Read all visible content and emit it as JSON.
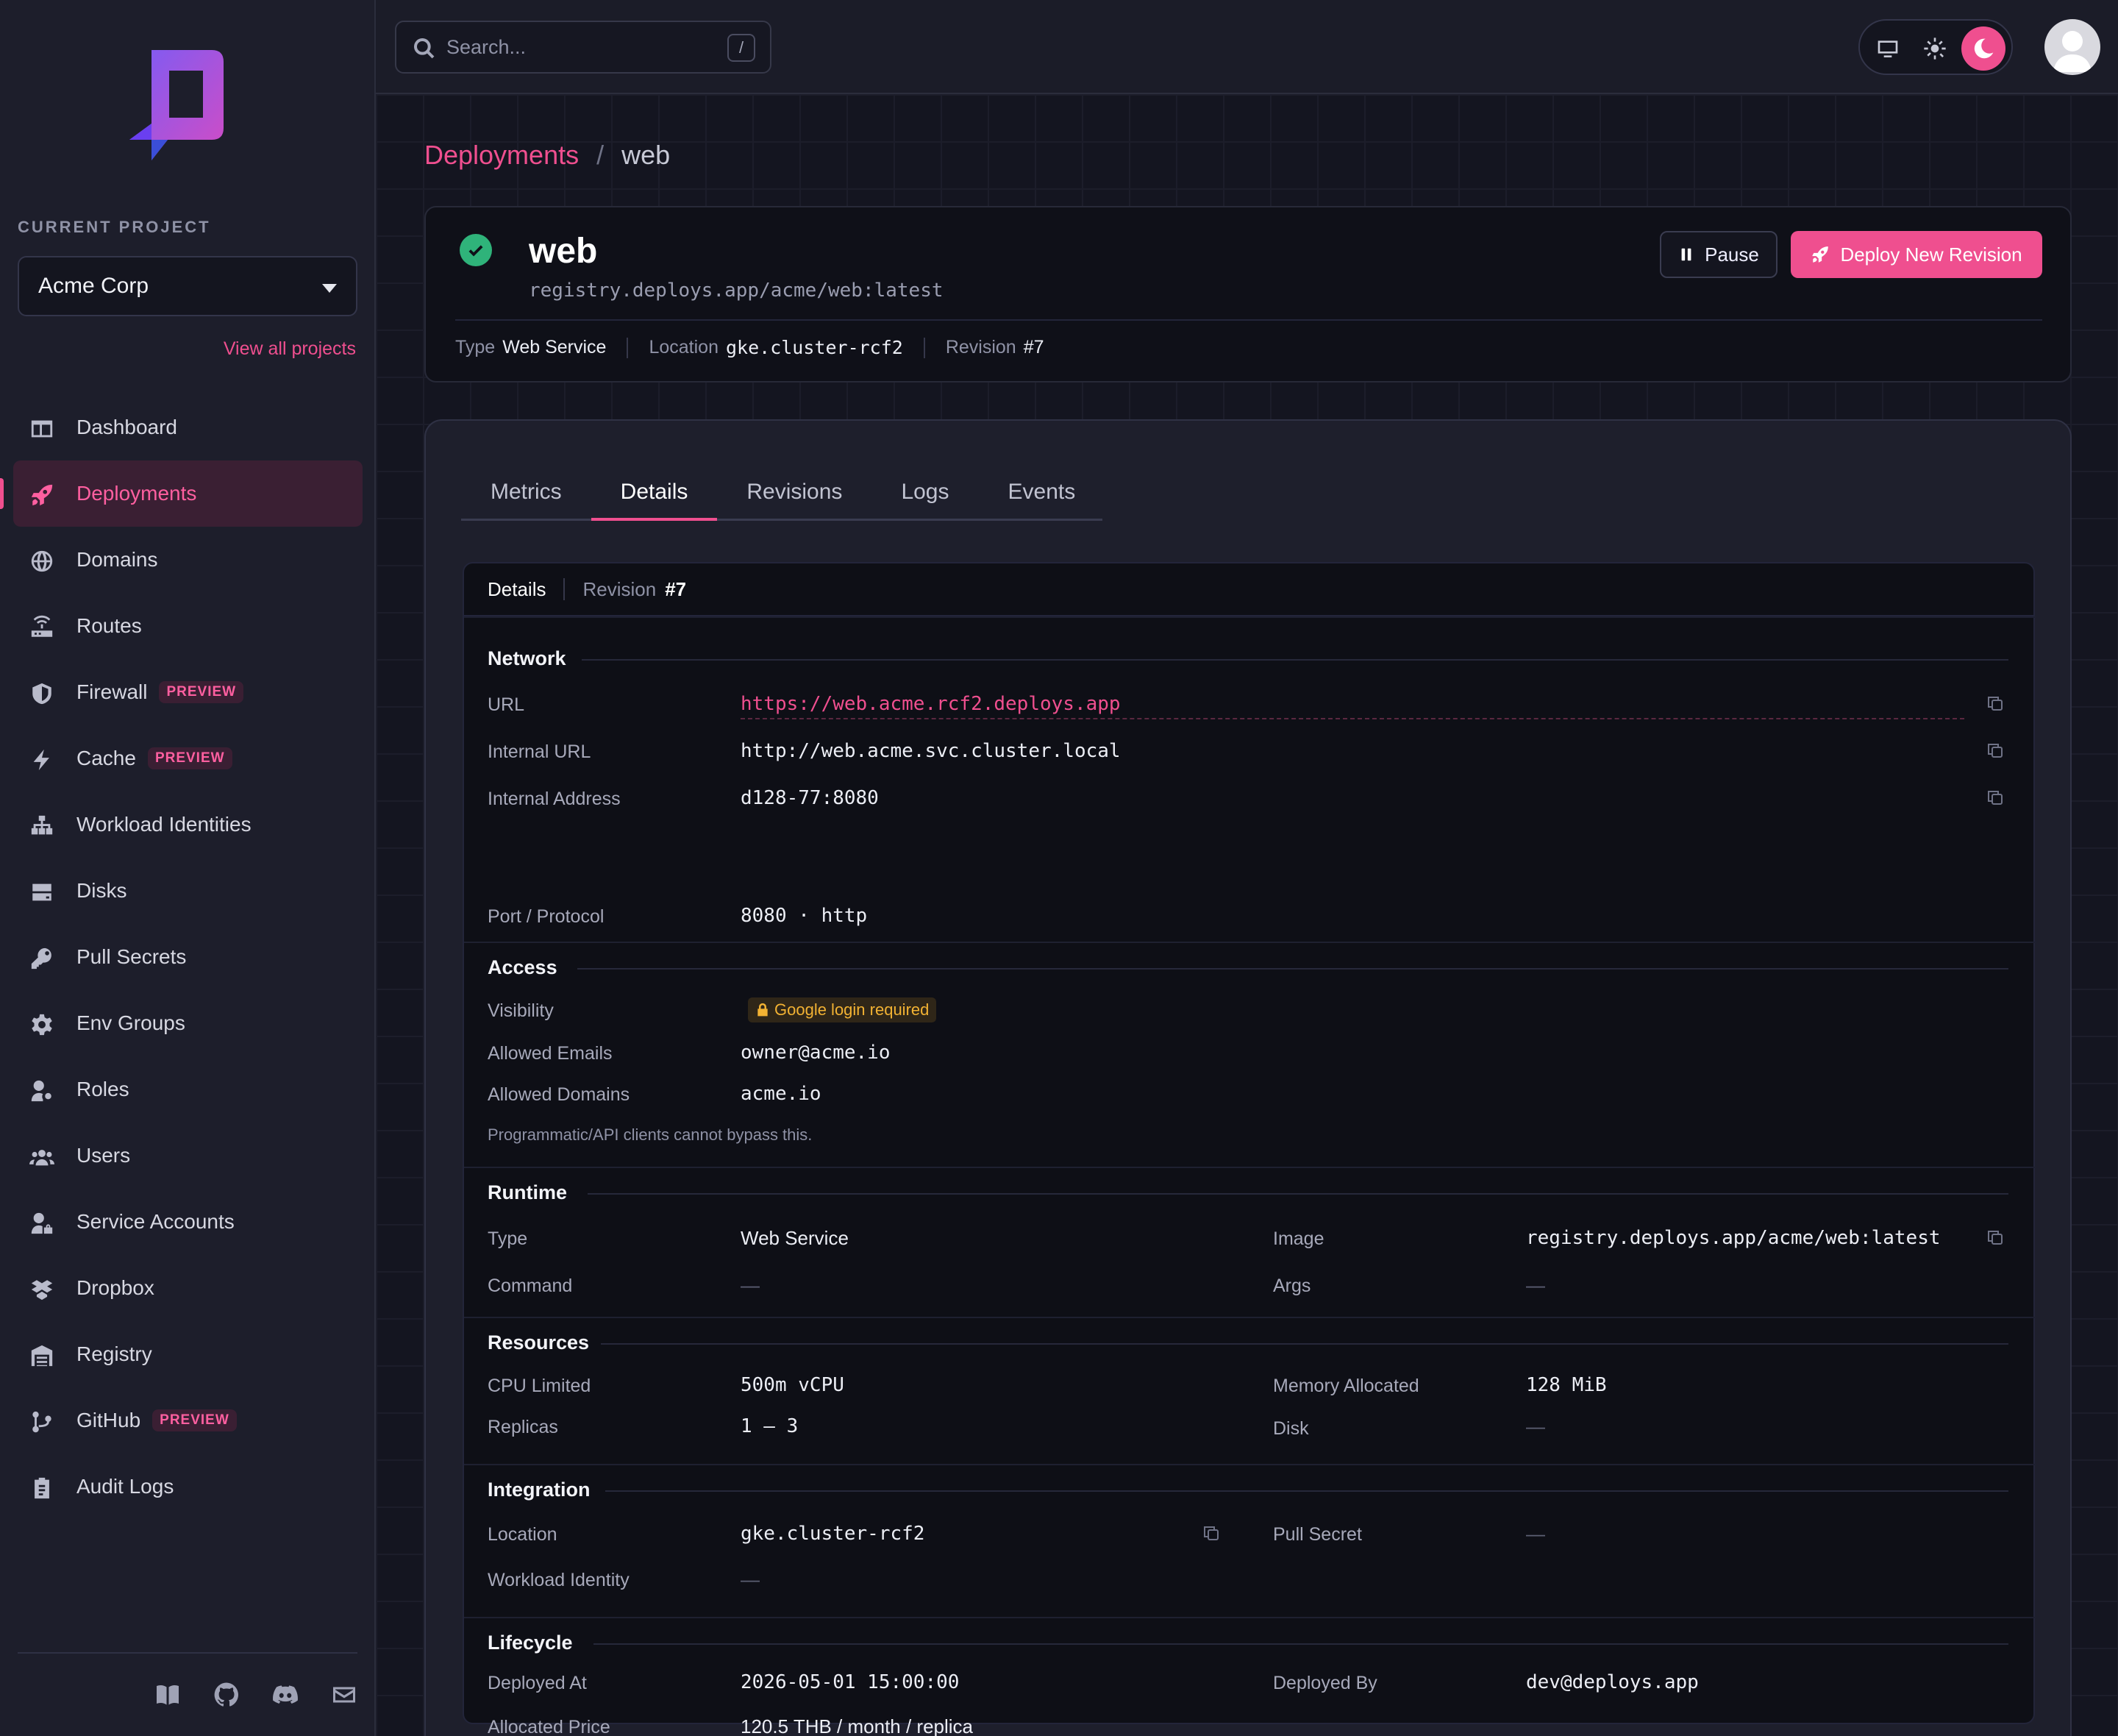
{
  "sidebar": {
    "current_project_label": "CURRENT PROJECT",
    "project_name": "Acme Corp",
    "view_all": "View all projects",
    "nav": [
      {
        "label": "Dashboard",
        "icon": "dashboard-icon"
      },
      {
        "label": "Deployments",
        "icon": "rocket-icon",
        "active": true
      },
      {
        "label": "Domains",
        "icon": "globe-icon"
      },
      {
        "label": "Routes",
        "icon": "router-icon"
      },
      {
        "label": "Firewall",
        "icon": "shield-icon",
        "badge": "PREVIEW"
      },
      {
        "label": "Cache",
        "icon": "bolt-icon",
        "badge": "PREVIEW"
      },
      {
        "label": "Workload Identities",
        "icon": "sitemap-icon"
      },
      {
        "label": "Disks",
        "icon": "disk-icon"
      },
      {
        "label": "Pull Secrets",
        "icon": "key-icon"
      },
      {
        "label": "Env Groups",
        "icon": "gear-icon"
      },
      {
        "label": "Roles",
        "icon": "user-gear-icon"
      },
      {
        "label": "Users",
        "icon": "users-icon"
      },
      {
        "label": "Service Accounts",
        "icon": "user-lock-icon"
      },
      {
        "label": "Dropbox",
        "icon": "box-icon"
      },
      {
        "label": "Registry",
        "icon": "warehouse-icon"
      },
      {
        "label": "GitHub",
        "icon": "branch-icon",
        "badge": "PREVIEW"
      },
      {
        "label": "Audit Logs",
        "icon": "clipboard-icon"
      }
    ],
    "footer_icons": [
      "book-icon",
      "github-icon",
      "discord-icon",
      "mail-icon"
    ]
  },
  "topbar": {
    "search_placeholder": "Search...",
    "search_shortcut": "/",
    "theme_modes": [
      "monitor-icon",
      "sun-icon",
      "moon-icon"
    ],
    "active_theme": "moon-icon"
  },
  "breadcrumb": {
    "parent": "Deployments",
    "separator": "/",
    "current": "web"
  },
  "deployment": {
    "name": "web",
    "image": "registry.deploys.app/acme/web:latest",
    "status": "check-circle-icon",
    "pause_label": "Pause",
    "deploy_label": "Deploy New Revision",
    "meta": {
      "type_label": "Type",
      "type_value": "Web Service",
      "location_label": "Location",
      "location_value": "gke.cluster-rcf2",
      "revision_label": "Revision",
      "revision_value": "#7"
    }
  },
  "tabs": [
    "Metrics",
    "Details",
    "Revisions",
    "Logs",
    "Events"
  ],
  "active_tab": "Details",
  "details": {
    "head_title": "Details",
    "revision_label": "Revision",
    "revision_value": "#7",
    "network": {
      "title": "Network",
      "url_label": "URL",
      "url": "https://web.acme.rcf2.deploys.app",
      "internal_url_label": "Internal URL",
      "internal_url": "http://web.acme.svc.cluster.local",
      "internal_address_label": "Internal Address",
      "internal_address": "d128-77:8080",
      "port_label": "Port / Protocol",
      "port": "8080 · http"
    },
    "access": {
      "title": "Access",
      "visibility_label": "Visibility",
      "visibility": "Google login required",
      "emails_label": "Allowed Emails",
      "emails": "owner@acme.io",
      "domains_label": "Allowed Domains",
      "domains": "acme.io",
      "note": "Programmatic/API clients cannot bypass this."
    },
    "runtime": {
      "title": "Runtime",
      "type_label": "Type",
      "type": "Web Service",
      "image_label": "Image",
      "image": "registry.deploys.app/acme/web:latest",
      "command_label": "Command",
      "command": "—",
      "args_label": "Args",
      "args": "—"
    },
    "resources": {
      "title": "Resources",
      "cpu_label": "CPU Limited",
      "cpu": "500m vCPU",
      "memory_label": "Memory Allocated",
      "memory": "128 MiB",
      "replicas_label": "Replicas",
      "replicas": "1 – 3",
      "disk_label": "Disk",
      "disk": "—"
    },
    "integration": {
      "title": "Integration",
      "location_label": "Location",
      "location": "gke.cluster-rcf2",
      "pull_secret_label": "Pull Secret",
      "pull_secret": "—",
      "workload_label": "Workload Identity",
      "workload": "—"
    },
    "lifecycle": {
      "title": "Lifecycle",
      "deployed_at_label": "Deployed At",
      "deployed_at": "2026-05-01 15:00:00",
      "deployed_by_label": "Deployed By",
      "deployed_by": "dev@deploys.app",
      "price_label": "Allocated Price",
      "price": "120.5 THB / month / replica"
    }
  },
  "colors": {
    "accent": "#ef4f8f",
    "success": "#2fb37a",
    "warning": "#f2b233",
    "bg": "#141520"
  }
}
